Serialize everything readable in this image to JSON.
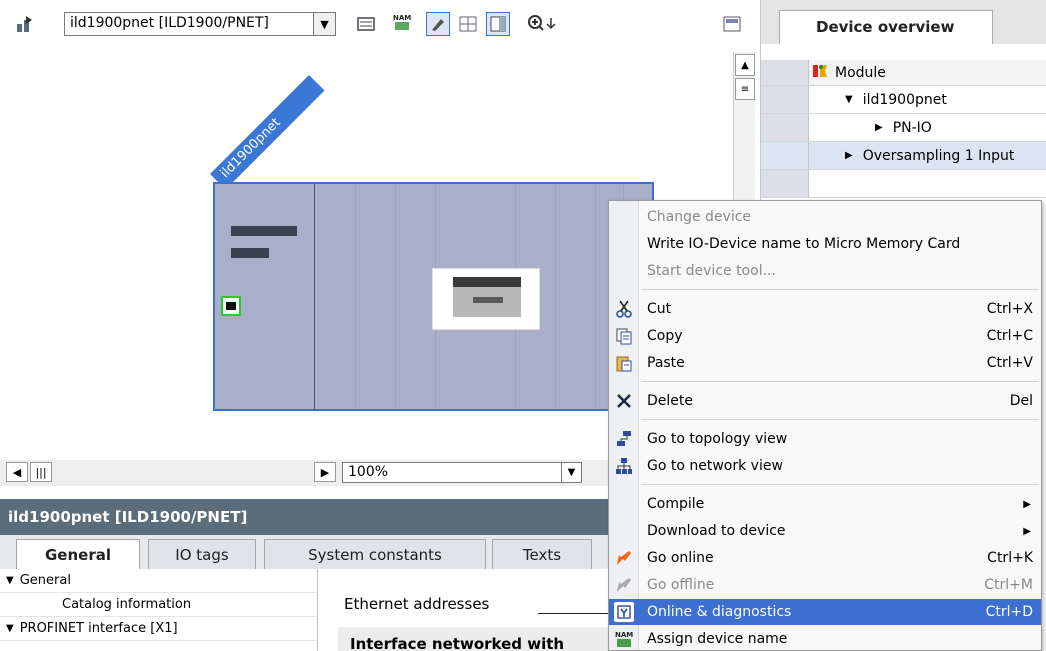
{
  "toolbar": {
    "device_select_value": "ild1900pnet [ILD1900/PNET]",
    "icons": [
      "network-add-icon",
      "device-list-icon",
      "name-assign-icon",
      "show-labels-icon",
      "grid-icon",
      "table-view-icon",
      "zoom-icon"
    ]
  },
  "canvas": {
    "device_label": "ild1900pnet",
    "zoom_value": "100%"
  },
  "overview": {
    "tab_label": "Device overview",
    "header": "Module",
    "rows": [
      {
        "label": "ild1900pnet",
        "expander": "▼"
      },
      {
        "label": "PN-IO",
        "expander": "▶"
      },
      {
        "label": "Oversampling 1 Input",
        "expander": "▶"
      }
    ]
  },
  "properties": {
    "title": "ild1900pnet [ILD1900/PNET]",
    "tabs": [
      "General",
      "IO tags",
      "System constants",
      "Texts"
    ],
    "nav": [
      {
        "label": "General",
        "expander": "▼"
      },
      {
        "label": "Catalog information",
        "expander": ""
      },
      {
        "label": "PROFINET interface [X1]",
        "expander": "▼"
      }
    ],
    "content_label": "Ethernet addresses",
    "interface_box": "Interface networked with"
  },
  "menu": {
    "items": [
      {
        "label": "Change device",
        "shortcut": "",
        "state": "disabled",
        "icon": ""
      },
      {
        "label": "Write IO-Device name to Micro Memory Card",
        "shortcut": "",
        "state": "normal",
        "icon": ""
      },
      {
        "label": "Start device tool...",
        "shortcut": "",
        "state": "disabled",
        "icon": ""
      },
      {
        "label": "Cut",
        "shortcut": "Ctrl+X",
        "state": "normal",
        "icon": "scissors-icon"
      },
      {
        "label": "Copy",
        "shortcut": "Ctrl+C",
        "state": "normal",
        "icon": "copy-icon"
      },
      {
        "label": "Paste",
        "shortcut": "Ctrl+V",
        "state": "normal",
        "icon": "paste-icon"
      },
      {
        "label": "Delete",
        "shortcut": "Del",
        "state": "normal",
        "icon": "delete-icon"
      },
      {
        "label": "Go to topology view",
        "shortcut": "",
        "state": "normal",
        "icon": "topology-icon"
      },
      {
        "label": "Go to network view",
        "shortcut": "",
        "state": "normal",
        "icon": "network-icon"
      },
      {
        "label": "Compile",
        "shortcut": "",
        "state": "normal",
        "icon": "",
        "submenu": true
      },
      {
        "label": "Download to device",
        "shortcut": "",
        "state": "normal",
        "icon": "",
        "submenu": true
      },
      {
        "label": "Go online",
        "shortcut": "Ctrl+K",
        "state": "normal",
        "icon": "go-online-icon"
      },
      {
        "label": "Go offline",
        "shortcut": "Ctrl+M",
        "state": "disabled",
        "icon": "go-offline-icon"
      },
      {
        "label": "Online & diagnostics",
        "shortcut": "Ctrl+D",
        "state": "highlighted",
        "icon": "diagnostics-icon"
      },
      {
        "label": "Assign device name",
        "shortcut": "",
        "state": "normal",
        "icon": "name-assign-icon"
      }
    ]
  },
  "colors": {
    "accent": "#3d6fd1",
    "rack": "#a9afc9",
    "title_bar": "#5b6c7a"
  }
}
